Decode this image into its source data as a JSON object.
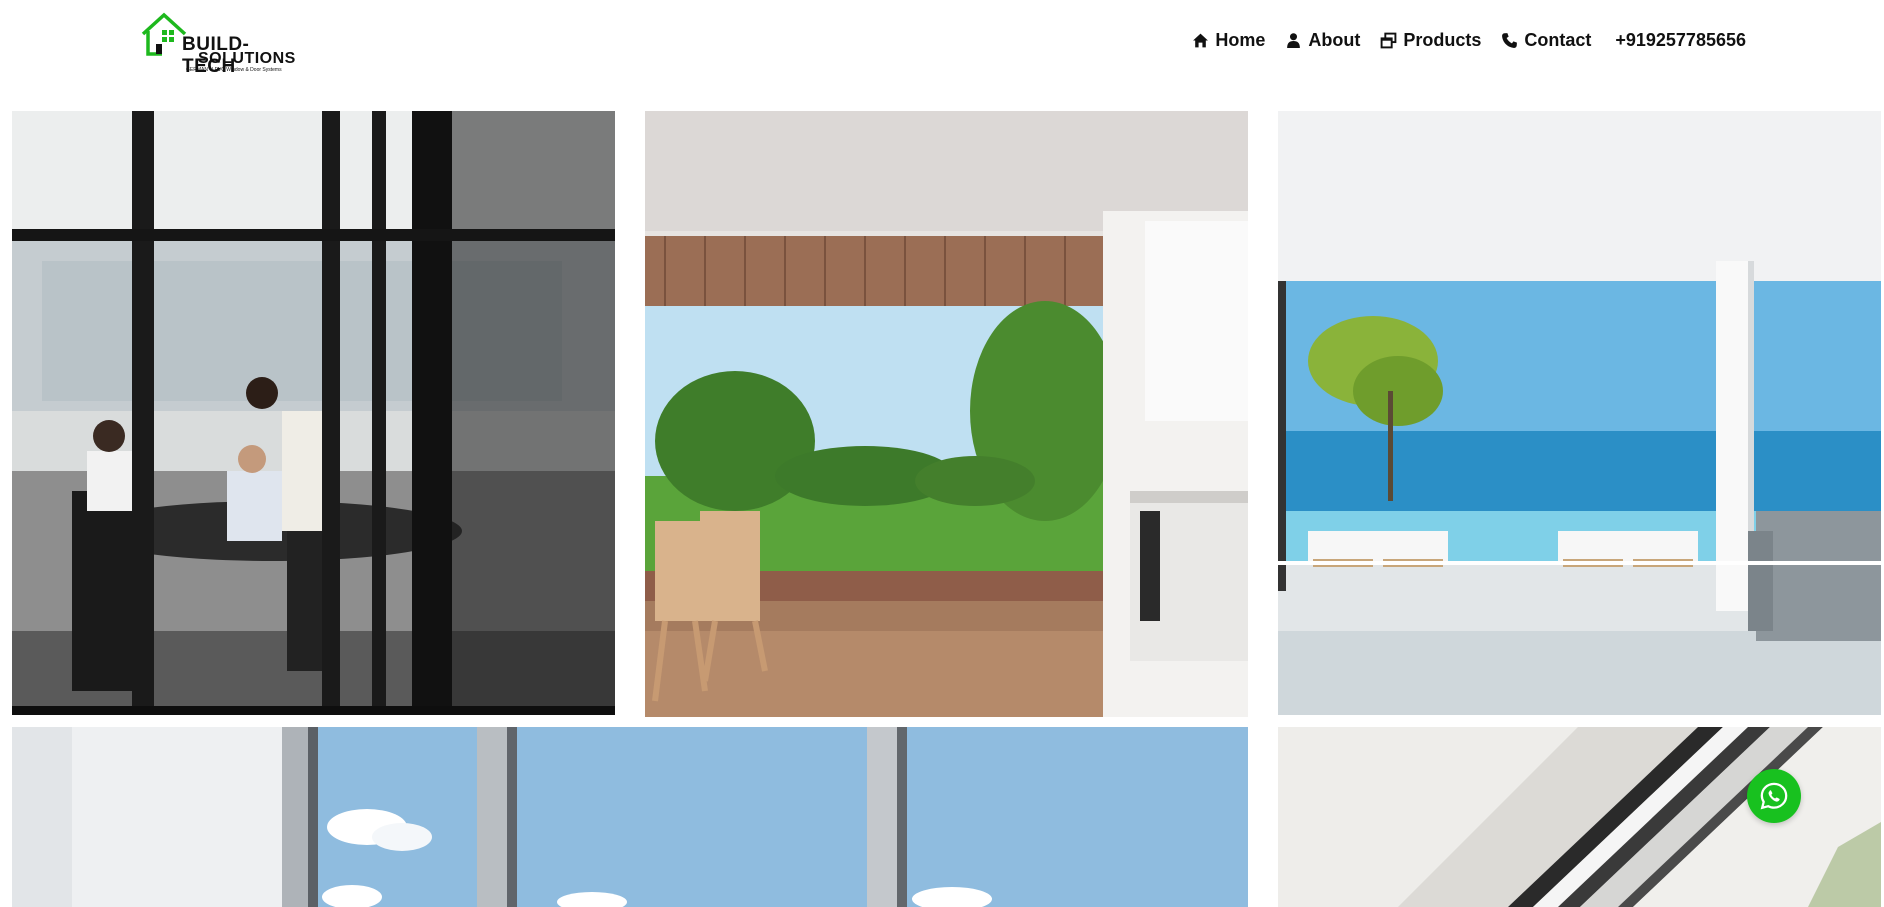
{
  "brand": {
    "name_line1": "BUILD-TECH",
    "name_line2": "SOLUTIONS",
    "tagline": "GERMAN U-PVC Window & Door Systems",
    "logo_color": "#1db81d"
  },
  "nav": {
    "items": [
      {
        "label": "Home",
        "icon": "home-icon"
      },
      {
        "label": "About",
        "icon": "user-icon"
      },
      {
        "label": "Products",
        "icon": "window-restore-icon"
      },
      {
        "label": "Contact",
        "icon": "phone-icon"
      }
    ],
    "phone": "+919257785656"
  },
  "gallery": [
    {
      "subject": "office-meeting-room-photo"
    },
    {
      "subject": "kitchen-open-to-garden-photo"
    },
    {
      "subject": "seaside-terrace-living-room-photo"
    },
    {
      "subject": "floor-to-ceiling-windows-sky-photo"
    },
    {
      "subject": "window-frame-detail-photo"
    }
  ],
  "whatsapp": {
    "icon": "whatsapp-icon",
    "color": "#18c11f"
  }
}
